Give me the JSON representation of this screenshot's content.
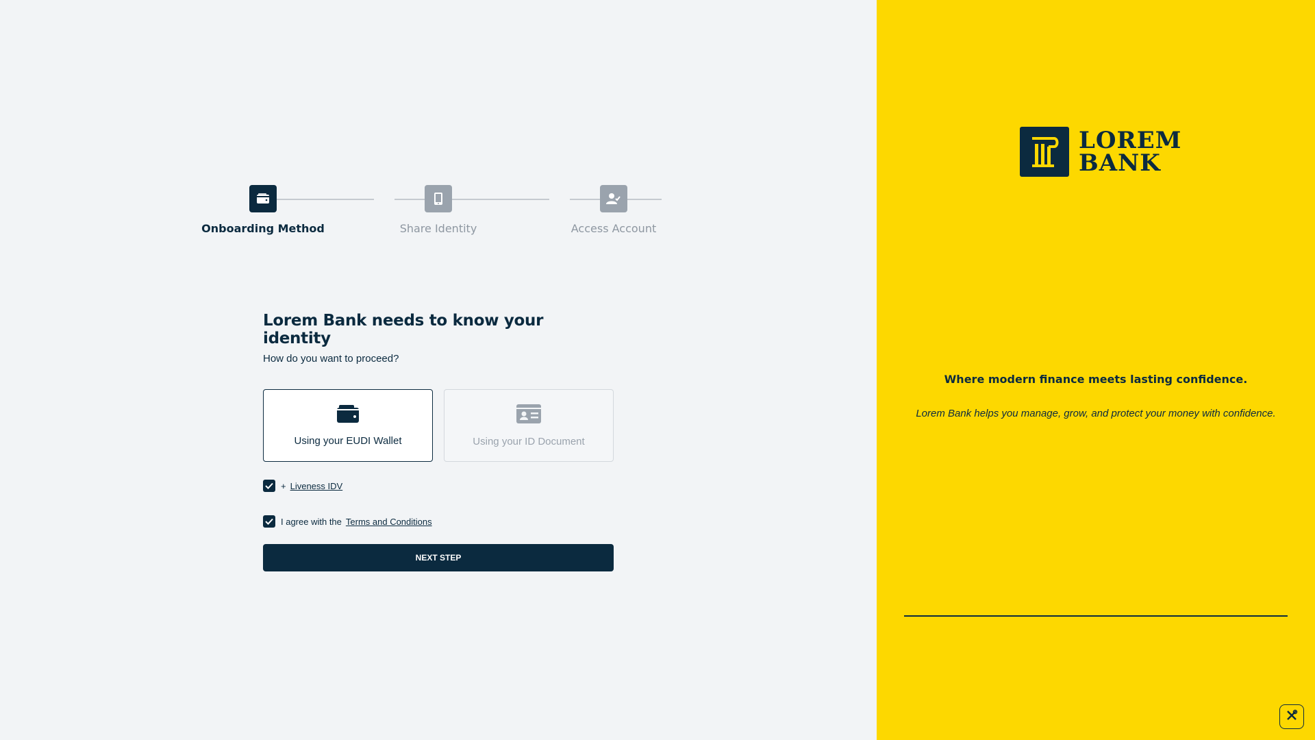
{
  "colors": {
    "brand": "#0b2a3f",
    "accent": "#fdd800",
    "muted": "#9aa3ad",
    "background": "#f2f4f6"
  },
  "stepper": {
    "steps": [
      {
        "label": "Onboarding Method",
        "icon": "wallet-icon",
        "state": "active"
      },
      {
        "label": "Share Identity",
        "icon": "smartphone-icon",
        "state": "inactive"
      },
      {
        "label": "Access Account",
        "icon": "user-check-icon",
        "state": "inactive"
      }
    ]
  },
  "form": {
    "title": "Lorem Bank needs to know your identity",
    "subtitle": "How do you want to proceed?",
    "options": [
      {
        "label": "Using your EUDI Wallet",
        "icon": "wallet-icon",
        "selected": true
      },
      {
        "label": "Using your ID Document",
        "icon": "id-card-icon",
        "selected": false
      }
    ],
    "liveness": {
      "prefix": "+",
      "link": "Liveness IDV",
      "checked": true
    },
    "terms": {
      "text": "I agree with the",
      "link": "Terms and Conditions",
      "checked": true
    },
    "next_button": "NEXT STEP"
  },
  "brand": {
    "logo_line1": "LOREM",
    "logo_line2": "BANK",
    "tagline": "Where modern finance meets lasting confidence.",
    "description": "Lorem Bank helps you manage, grow, and protect your money with confidence."
  },
  "tools": {
    "icon": "tools-icon"
  }
}
